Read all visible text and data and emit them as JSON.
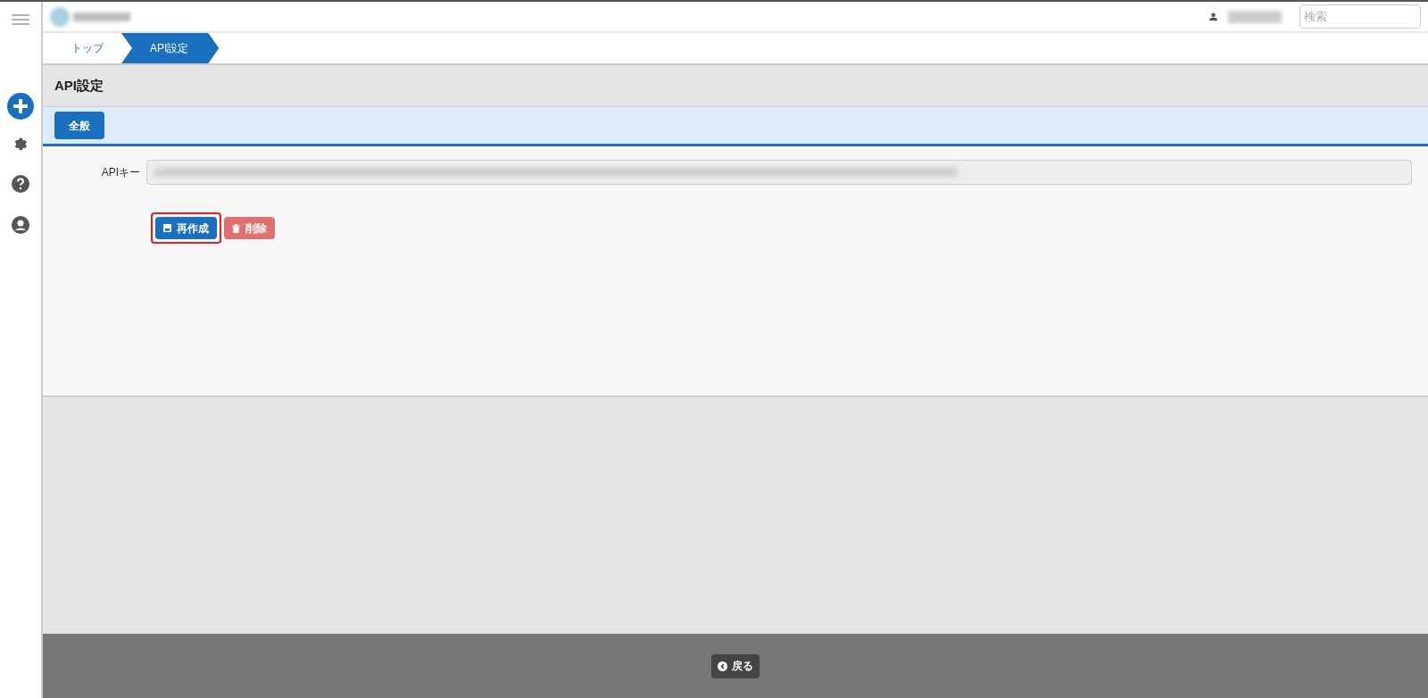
{
  "header": {
    "search": {
      "placeholder": "検索"
    }
  },
  "breadcrumbs": [
    {
      "label": "トップ",
      "selected": false
    },
    {
      "label": "API設定",
      "selected": true
    }
  ],
  "page_title": "API設定",
  "tabs": [
    {
      "label": "全般",
      "selected": true
    }
  ],
  "form": {
    "api_key_label": "APIキー"
  },
  "actions": [
    {
      "kind": "regenerate",
      "label": "再作成",
      "highlighted": true
    },
    {
      "kind": "delete",
      "label": "削除",
      "highlighted": false
    }
  ],
  "footer": {
    "back_label": "戻る"
  }
}
